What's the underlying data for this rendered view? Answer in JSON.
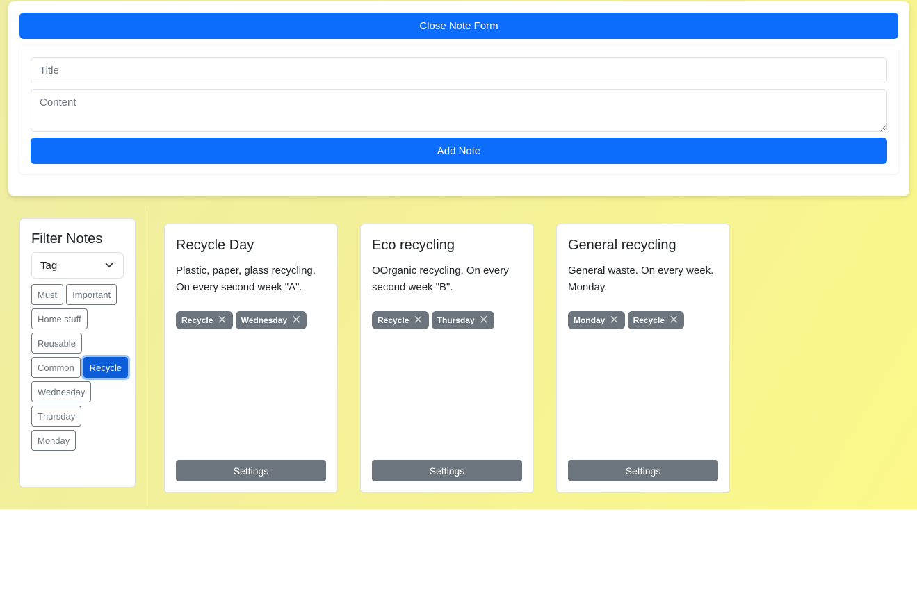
{
  "form": {
    "close_label": "Close Note Form",
    "title_placeholder": "Title",
    "content_placeholder": "Content",
    "add_label": "Add Note"
  },
  "filter": {
    "heading": "Filter Notes",
    "select_value": "Tag",
    "tags": [
      "Must",
      "Important",
      "Home stuff",
      "Reusable",
      "Common",
      "Recycle",
      "Wednesday",
      "Thursday",
      "Monday"
    ],
    "active_tag": "Recycle"
  },
  "notes": [
    {
      "title": "Recycle Day",
      "content": "Plastic, paper, glass recycling. On every second week \"A\".",
      "tags": [
        "Recycle",
        "Wednesday"
      ],
      "settings_label": "Settings"
    },
    {
      "title": "Eco recycling",
      "content": "OOrganic recycling. On every second week \"B\".",
      "tags": [
        "Recycle",
        "Thursday"
      ],
      "settings_label": "Settings"
    },
    {
      "title": "General recycling",
      "content": "General waste. On every week. Monday.",
      "tags": [
        "Monday",
        "Recycle"
      ],
      "settings_label": "Settings"
    }
  ],
  "colors": {
    "primary": "#0d6efd",
    "secondary": "#6c757d"
  }
}
